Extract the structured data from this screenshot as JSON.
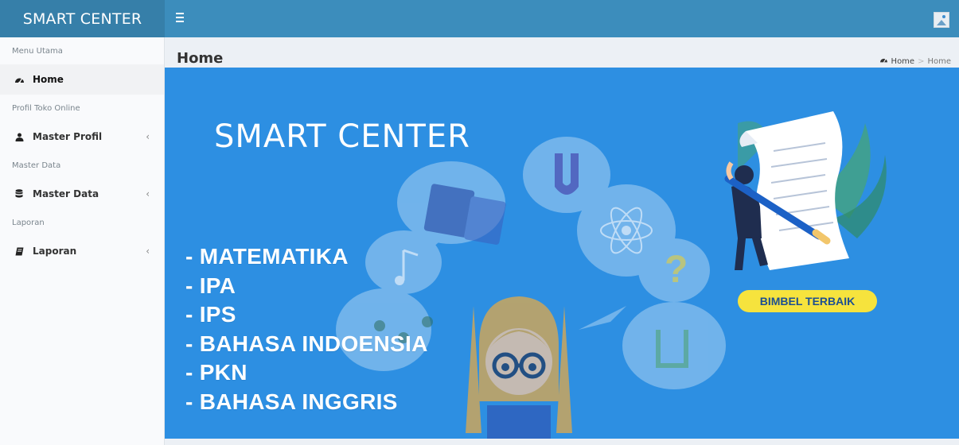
{
  "header": {
    "logo_text": "SMART CENTER",
    "menu_toggle_icon": "hamburger-icon",
    "user_image_icon": "broken-image-icon"
  },
  "sidebar": {
    "sections": [
      {
        "header": "Menu Utama",
        "item": {
          "label": "Home",
          "icon": "dashboard-icon",
          "active": true,
          "has_children": false
        }
      },
      {
        "header": "Profil Toko Online",
        "item": {
          "label": "Master Profil",
          "icon": "user-icon",
          "active": false,
          "has_children": true
        }
      },
      {
        "header": "Master Data",
        "item": {
          "label": "Master Data",
          "icon": "database-icon",
          "active": false,
          "has_children": true
        }
      },
      {
        "header": "Laporan",
        "item": {
          "label": "Laporan",
          "icon": "book-icon",
          "active": false,
          "has_children": true
        }
      }
    ],
    "chevron": "‹"
  },
  "content": {
    "title": "Home",
    "breadcrumb": {
      "home_label": "Home",
      "separator": ">",
      "current": "Home"
    }
  },
  "banner": {
    "title": "SMART CENTER",
    "subjects": [
      "- MATEMATIKA",
      "- IPA",
      "- IPS",
      "- BAHASA INDOENSIA",
      "- PKN",
      "- BAHASA INGGRIS"
    ],
    "badge": "BIMBEL TERBAIK"
  },
  "colors": {
    "logo_bg": "#367fa9",
    "navbar_bg": "#3c8dbc",
    "banner_bg": "#2d8fe2",
    "badge_bg": "#f6e33d",
    "badge_text": "#1d4f91"
  }
}
